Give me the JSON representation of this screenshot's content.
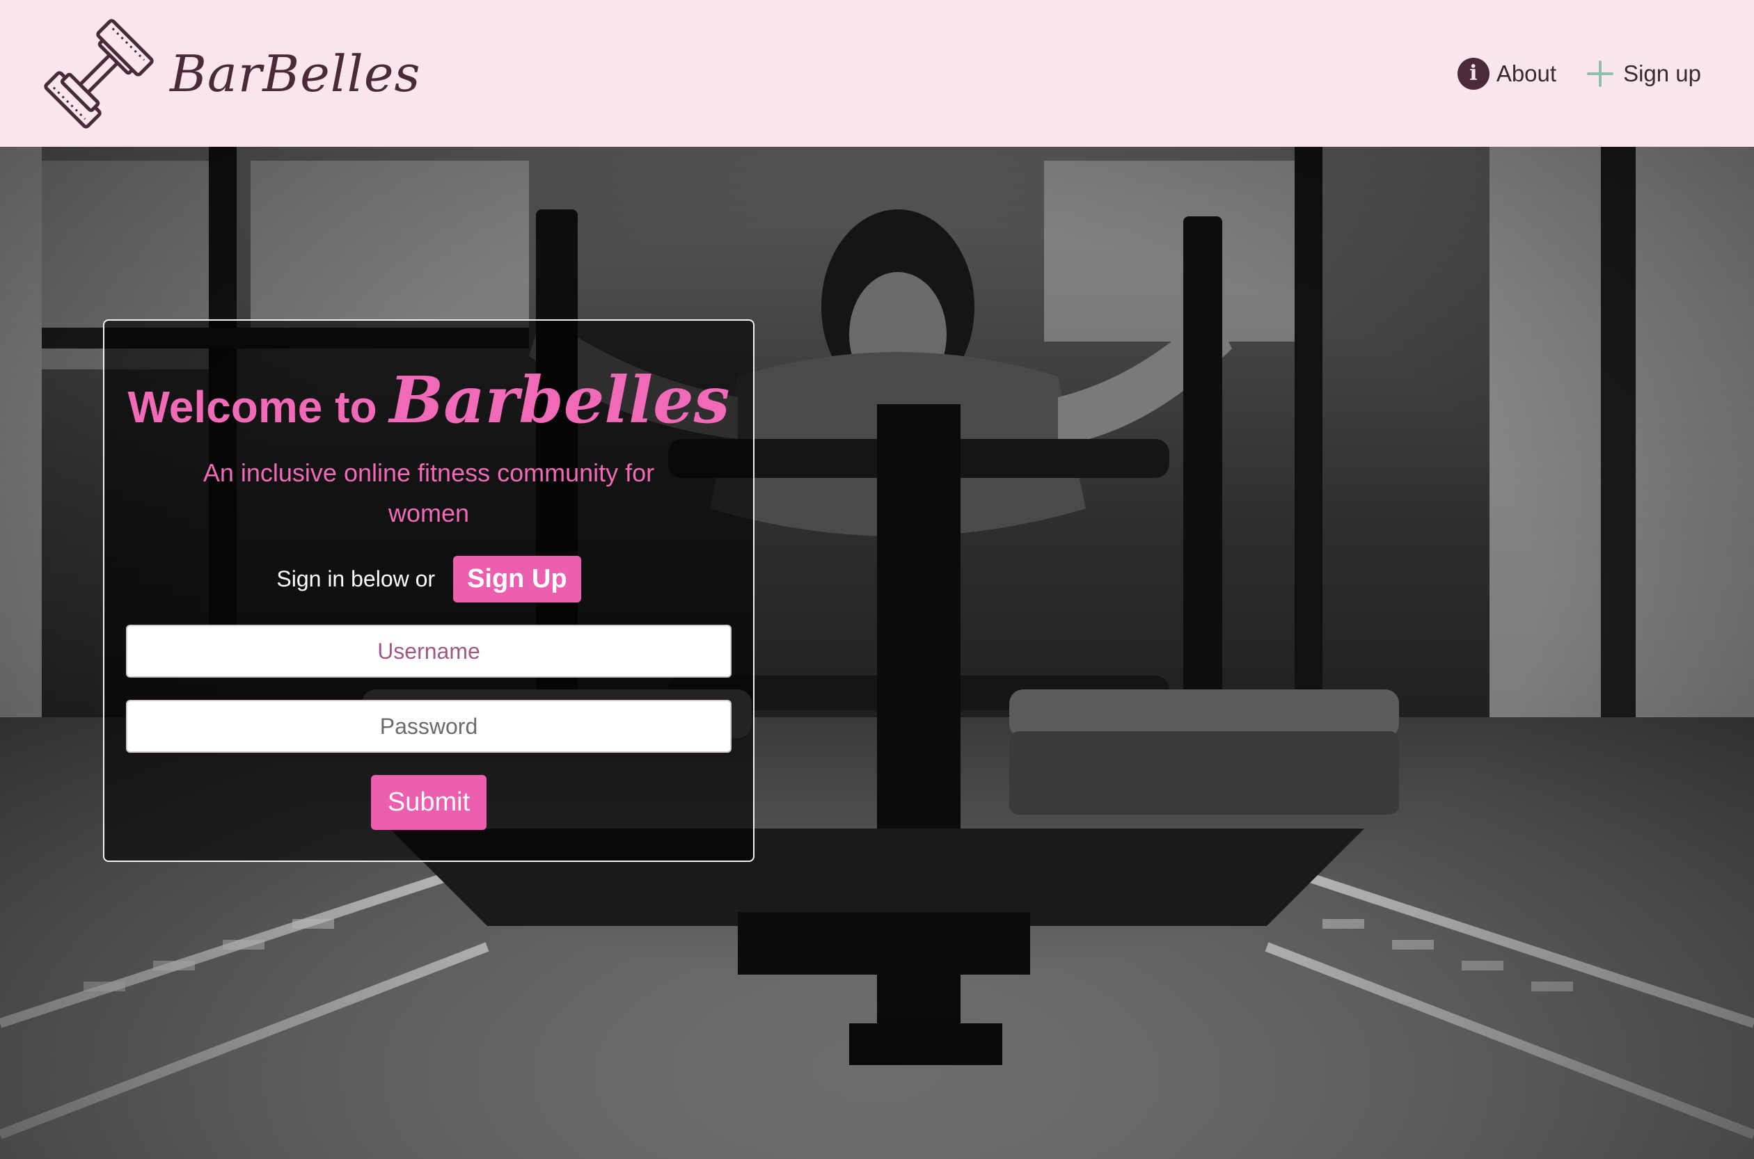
{
  "header": {
    "brand": "BarBelles",
    "nav": [
      {
        "label": "About",
        "icon": "info-icon"
      },
      {
        "label": "Sign up",
        "icon": "plus-icon"
      }
    ]
  },
  "hero": {
    "image_description_icon": "gym-sled-photo"
  },
  "login": {
    "welcome_lead": "Welcome to",
    "welcome_brand": "Barbelles",
    "tagline": "An inclusive online fitness community for women",
    "signin_text": "Sign in below or",
    "signup_button": "Sign Up",
    "username_placeholder": "Username",
    "password_placeholder": "Password",
    "submit_button": "Submit"
  },
  "colors": {
    "navbar_bg": "#fbe6ee",
    "brand_text": "#4a2a38",
    "accent_pink": "#ec5fae",
    "welcome_pink": "#f06ab8",
    "plus_icon": "#8fc0ad"
  }
}
